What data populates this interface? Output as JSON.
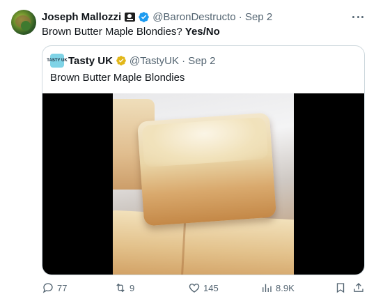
{
  "tweet": {
    "author_name": "Joseph Mallozzi",
    "handle_date": "@BaronDestructo · Sep 2",
    "text": "Brown Butter Maple Blondies?",
    "text_bold": "Yes/No"
  },
  "quote": {
    "author_name": "Tasty UK",
    "avatar_text": "TASTY UK",
    "handle_date": "@TastyUK · Sep 2",
    "text": "Brown Butter Maple Blondies"
  },
  "actions": {
    "replies": "77",
    "retweets": "9",
    "likes": "145",
    "views": "8.9K"
  },
  "icons": {
    "verified": "verified-badge-icon",
    "gold_verified": "gold-verified-badge-icon",
    "emoji": "pirate-flag-icon",
    "more": "more-icon",
    "reply": "reply-icon",
    "retweet": "retweet-icon",
    "like": "heart-icon",
    "views": "views-chart-icon",
    "bookmark": "bookmark-icon",
    "share": "share-icon"
  },
  "colors": {
    "text": "#0f1419",
    "secondary": "#536471",
    "verified_blue": "#1d9bf0",
    "gold": "#e2b719",
    "border": "#cfd9de"
  }
}
